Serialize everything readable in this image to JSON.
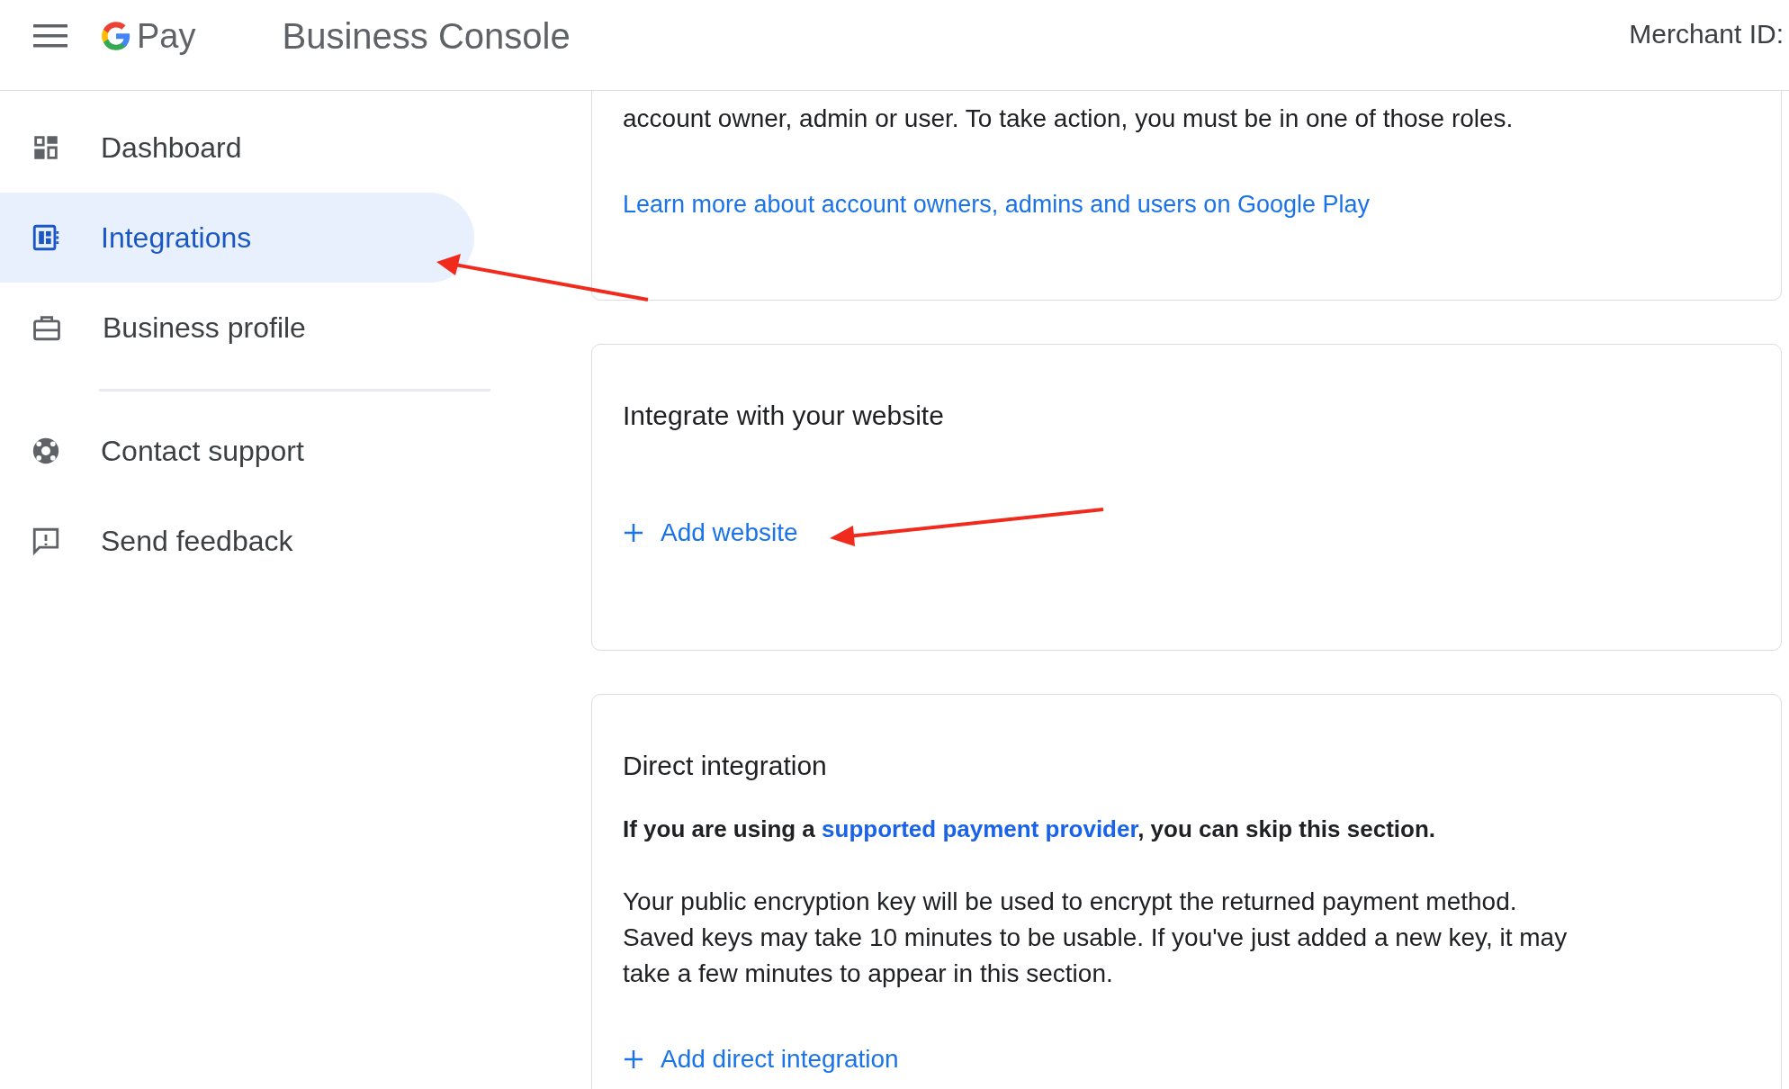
{
  "header": {
    "product": "Pay",
    "title": "Business Console",
    "merchant_label": "Merchant ID:"
  },
  "sidebar": {
    "items": [
      {
        "label": "Dashboard",
        "kind": "dashboard",
        "selected": false
      },
      {
        "label": "Integrations",
        "kind": "integrations",
        "selected": true
      },
      {
        "label": "Business profile",
        "kind": "profile",
        "selected": false
      },
      {
        "kind": "divider"
      },
      {
        "label": "Contact support",
        "kind": "support",
        "selected": false
      },
      {
        "label": "Send feedback",
        "kind": "feedback",
        "selected": false
      }
    ]
  },
  "cards": [
    {
      "paragraphs": [
        "account owner, admin or user. To take action, you must be in one of those roles."
      ],
      "link": "Learn more about account owners, admins and users on Google Play"
    },
    {
      "title": "Integrate with your website",
      "action": "Add website"
    },
    {
      "title": "Direct integration",
      "notice": {
        "before": "If you are using a",
        "link": "supported payment provider",
        "after": ", you can skip this section."
      },
      "paragraphs": [
        "Your public encryption key will be used to encrypt the returned payment method. Saved keys may take 10 minutes to be usable. If you've just added a new key, it may take a few minutes to appear in this section."
      ],
      "action": "Add direct integration"
    }
  ]
}
